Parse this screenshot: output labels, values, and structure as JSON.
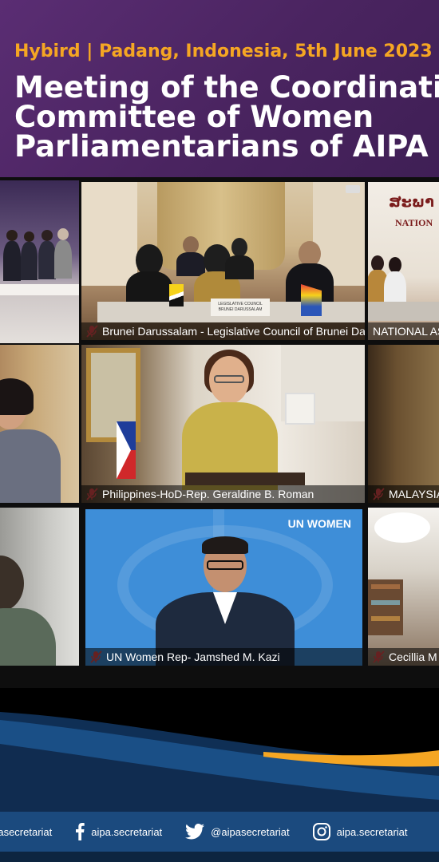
{
  "header": {
    "subtitle": "Hybird | Padang, Indonesia, 5th June 2023",
    "title_lines": [
      "Meeting of the Coordinating",
      "Committee of Women",
      "Parliamentarians of AIPA (WAIPA)"
    ]
  },
  "tiles": [
    {
      "label": ""
    },
    {
      "label": "Brunei Darussalam - Legislative Council of Brunei Darussalam",
      "sign": "LEGISLATIVE COUNCIL BRUNEI DARUSSALAM"
    },
    {
      "label": "NATIONAL ASSEMBLY OF LAO PDR",
      "sign": "NATION"
    },
    {
      "label": ""
    },
    {
      "label": "Philippines-HoD-Rep. Geraldine B. Roman"
    },
    {
      "label": "MALAYSIA"
    },
    {
      "label": ""
    },
    {
      "label": "UN Women Rep- Jamshed M. Kazi",
      "logo": "UN WOMEN"
    },
    {
      "label": "Cecillia M"
    }
  ],
  "social": [
    {
      "icon": "instagram-icon",
      "handle": "aipasecretariat"
    },
    {
      "icon": "facebook-icon",
      "handle": "aipa.secretariat"
    },
    {
      "icon": "twitter-icon",
      "handle": "@aipasecretariat"
    },
    {
      "icon": "instagram-icon",
      "handle": "aipa.secretariat"
    }
  ],
  "colors": {
    "accent": "#f5a623",
    "header_bg": "#4a2460",
    "footer_bar": "#1b4a7e",
    "active_speaker": "#e8e23a"
  }
}
